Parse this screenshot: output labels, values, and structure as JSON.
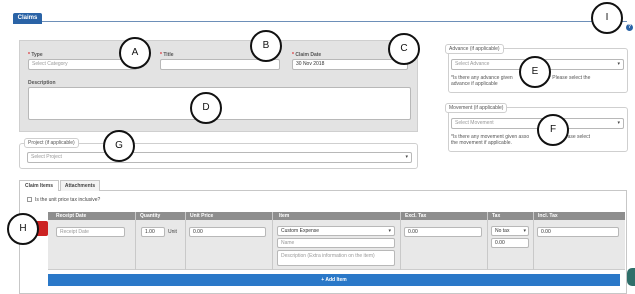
{
  "header": {
    "title": "Claims",
    "help_glyph": "?"
  },
  "form": {
    "type": {
      "label": "Type",
      "required_mark": "*",
      "placeholder": "Select Category"
    },
    "title": {
      "label": "Title",
      "required_mark": "*",
      "value": ""
    },
    "claim_date": {
      "label": "Claim Date",
      "required_mark": "*",
      "value": "30 Nov 2018"
    },
    "description": {
      "label": "Description",
      "value": ""
    }
  },
  "advance": {
    "legend": "Advance (if applicable)",
    "placeholder": "Select Advance",
    "hint_line1": "*Is there any advance given",
    "hint_line1_end": "the claim? Please select the",
    "hint_line2": "advance if applicable"
  },
  "movement": {
    "legend": "Movement (if applicable)",
    "placeholder": "Select Movement",
    "hint_line1": "*Is there any movement given asso",
    "hint_line1_end": "claim? Please select",
    "hint_line2": "the movement if applicable."
  },
  "project": {
    "legend": "Project (if applicable)",
    "placeholder": "Select Project"
  },
  "tabs": [
    {
      "label": "Claim Items",
      "active": true
    },
    {
      "label": "Attachments",
      "active": false
    }
  ],
  "tax_inclusive": {
    "label": "Is the unit price tax inclusive?",
    "checked": false
  },
  "grid": {
    "headers": [
      "Receipt Date",
      "Quantity",
      "Unit Price",
      "Item",
      "Excl. Tax",
      "Tax",
      "Incl. Tax"
    ],
    "row": {
      "receipt_date": "Receipt Date",
      "quantity": "1.00",
      "unit_label": "Unit",
      "unit_price": "0.00",
      "item_select": "Custom Expense",
      "item_name": "Name",
      "item_description": "Description (Extra information on the item)",
      "excl_tax": "0.00",
      "tax_select": "No tax",
      "tax_amount": "0.00",
      "incl_tax": "0.00"
    },
    "add_button": "+ Add Item"
  },
  "callouts": [
    "A",
    "B",
    "C",
    "D",
    "E",
    "F",
    "G",
    "H",
    "I"
  ],
  "colors": {
    "brand_blue": "#2a63a6",
    "grid_header": "#8e8e8e",
    "delete_red": "#cc2222",
    "add_blue": "#2a78c8"
  }
}
